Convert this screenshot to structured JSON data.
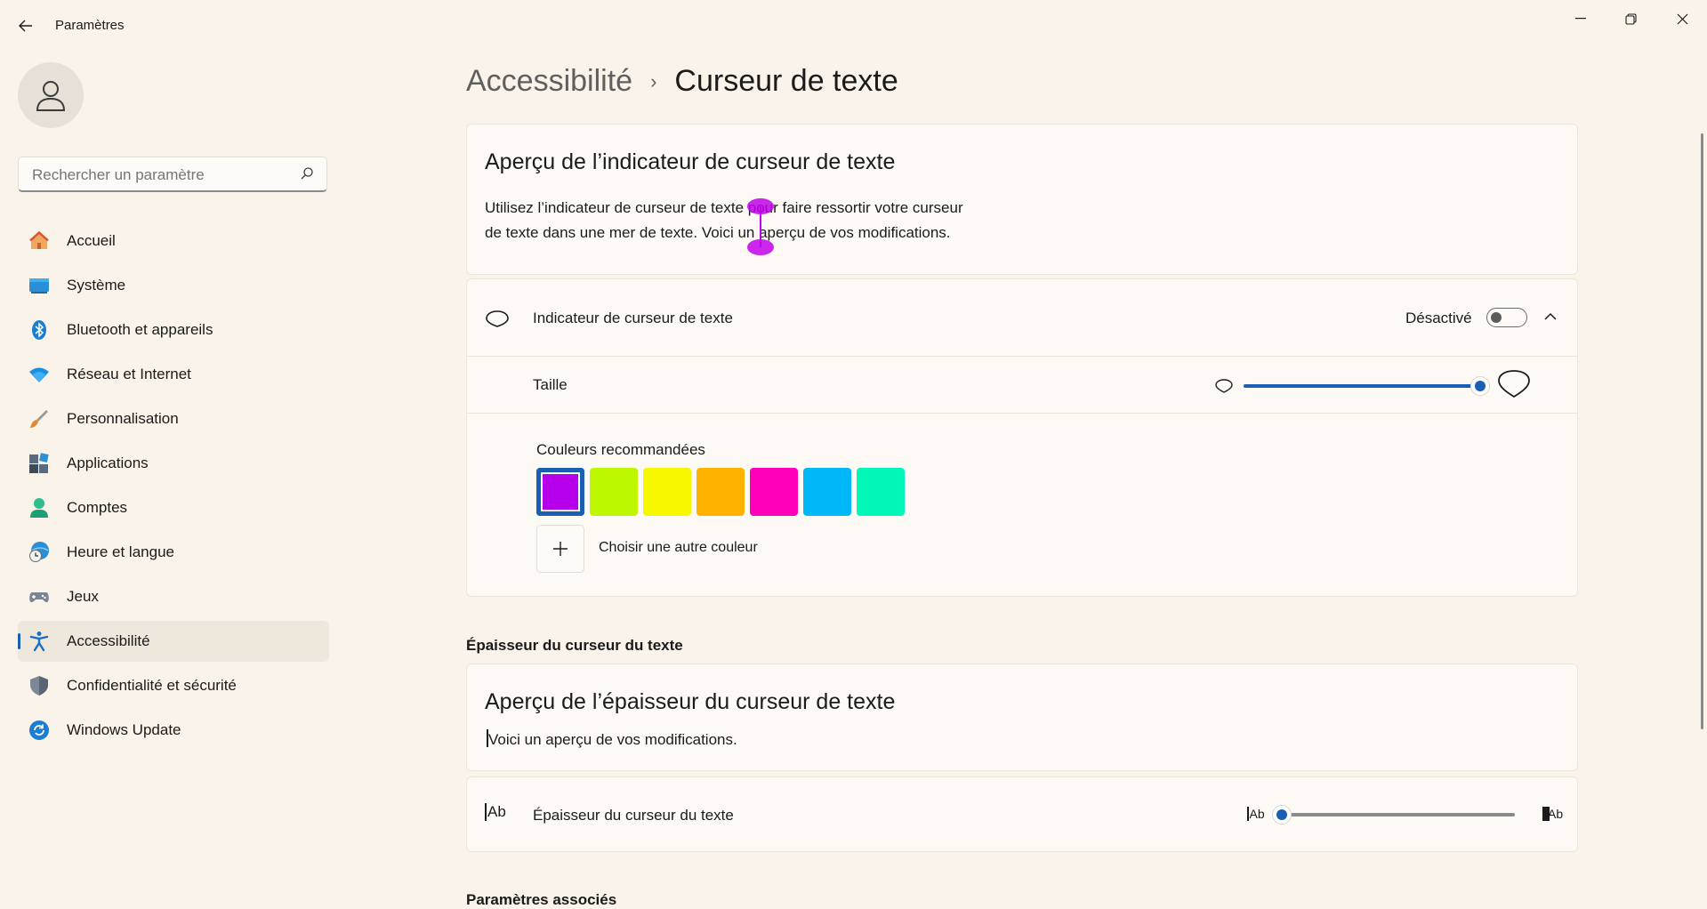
{
  "window": {
    "title": "Paramètres",
    "controls": [
      "minimize",
      "restore",
      "close"
    ]
  },
  "search": {
    "placeholder": "Rechercher un paramètre"
  },
  "sidebar": {
    "items": [
      {
        "label": "Accueil",
        "icon": "home-icon"
      },
      {
        "label": "Système",
        "icon": "system-icon"
      },
      {
        "label": "Bluetooth et appareils",
        "icon": "bluetooth-icon"
      },
      {
        "label": "Réseau et Internet",
        "icon": "wifi-icon"
      },
      {
        "label": "Personnalisation",
        "icon": "brush-icon"
      },
      {
        "label": "Applications",
        "icon": "apps-icon"
      },
      {
        "label": "Comptes",
        "icon": "account-icon"
      },
      {
        "label": "Heure et langue",
        "icon": "clock-globe-icon"
      },
      {
        "label": "Jeux",
        "icon": "gamepad-icon"
      },
      {
        "label": "Accessibilité",
        "icon": "accessibility-icon",
        "active": true
      },
      {
        "label": "Confidentialité et sécurité",
        "icon": "shield-icon"
      },
      {
        "label": "Windows Update",
        "icon": "update-icon"
      }
    ]
  },
  "breadcrumb": {
    "parent": "Accessibilité",
    "separator": "›",
    "current": "Curseur de texte"
  },
  "preview": {
    "title": "Aperçu de l’indicateur de curseur de texte",
    "text": "Utilisez l’indicateur de curseur de texte pour faire ressortir votre curseur de texte dans une mer de texte. Voici un aperçu de vos modifications."
  },
  "indicator": {
    "label": "Indicateur de curseur de texte",
    "state_label": "Désactivé",
    "toggle_on": false,
    "size_label": "Taille",
    "size_value": 1.0,
    "colors_label": "Couleurs recommandées",
    "colors": [
      "#b600ec",
      "#bdf700",
      "#f7f700",
      "#ffb300",
      "#ff00b8",
      "#00b7f7",
      "#00f7b8"
    ],
    "selected_color_index": 0,
    "custom_color_label": "Choisir une autre couleur"
  },
  "thickness": {
    "section_header": "Épaisseur du curseur du texte",
    "preview_title": "Aperçu de l’épaisseur du curseur de texte",
    "preview_text": "Voici un aperçu de vos modifications.",
    "row_label": "Épaisseur du curseur du texte",
    "icon_text": "Ab",
    "slider_value": 0.0
  },
  "related": {
    "header": "Paramètres associés"
  },
  "colors": {
    "accent": "#1a5fb4",
    "background": "#f9f3e9",
    "card": "#fdfaf5"
  }
}
